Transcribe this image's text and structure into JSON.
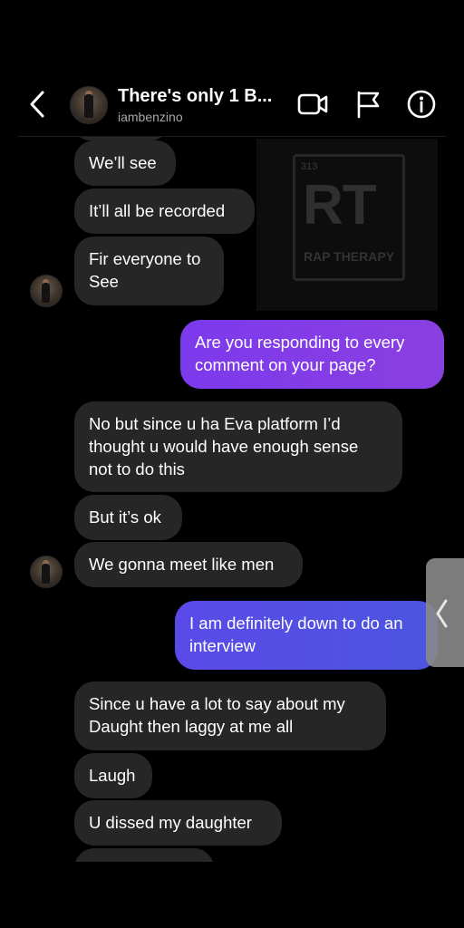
{
  "header": {
    "title": "There's only 1 B...",
    "username": "iambenzino"
  },
  "watermark": {
    "number": "313",
    "letters": "RT",
    "label": "RAP THERAPY"
  },
  "messages": {
    "m1": "We’ll see",
    "m2": "It’ll all be recorded",
    "m3a": "Fir everyone to",
    "m3b": "See",
    "m4a": "Are you responding to every",
    "m4b": "comment on your page?",
    "m5a": "No but since u ha Eva platform I’d",
    "m5b": "thought u would have enough sense",
    "m5c": "not to do this",
    "m6": "But it’s ok",
    "m7": "We gonna meet like men",
    "m8a": "I am definitely down to do an",
    "m8b": "interview",
    "m9a": "Since u have a lot to say about my",
    "m9b": "Daught then laggy at me all",
    "m10": "Laugh",
    "m11": "U dissed my daughter"
  },
  "colors": {
    "background": "#000000",
    "incoming_bubble": "#262626",
    "outgoing_purple": "#7c3aed",
    "outgoing_blue": "#4b55e0",
    "subtitle_gray": "#a8a8a8"
  },
  "icons": {
    "back": "chevron-left-icon",
    "video": "video-camera-icon",
    "flag": "flag-icon",
    "info": "info-icon",
    "handle": "chevron-left-icon"
  }
}
